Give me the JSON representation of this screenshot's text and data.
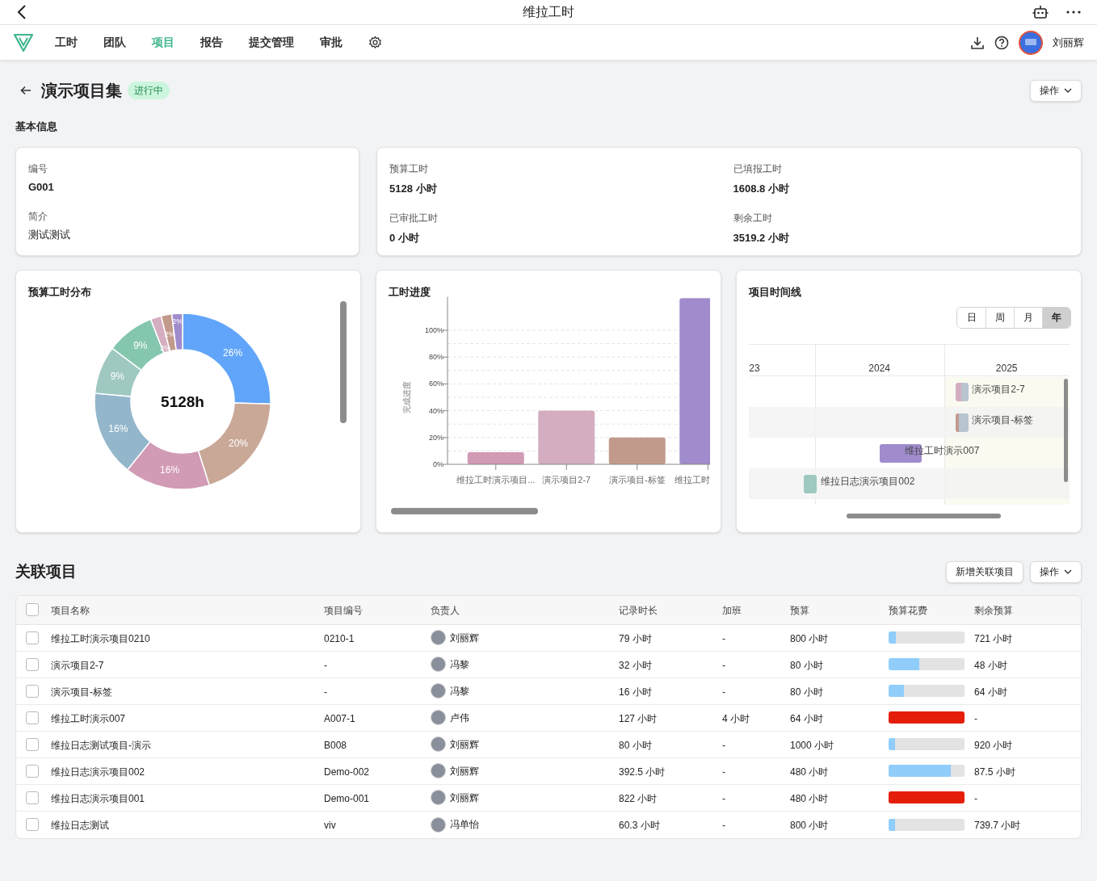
{
  "app_bar": {
    "title": "维拉工时"
  },
  "nav": {
    "items": [
      {
        "label": "工时",
        "selected": false
      },
      {
        "label": "团队",
        "selected": false
      },
      {
        "label": "项目",
        "selected": true
      },
      {
        "label": "报告",
        "selected": false
      },
      {
        "label": "提交管理",
        "selected": false
      },
      {
        "label": "审批",
        "selected": false
      }
    ],
    "user": "刘丽辉"
  },
  "header": {
    "title": "演示项目集",
    "status": "进行中",
    "action": "操作"
  },
  "basic_info": {
    "heading": "基本信息",
    "fields": [
      {
        "label": "编号",
        "value": "G001"
      },
      {
        "label": "简介",
        "value": "测试测试"
      }
    ],
    "hours": [
      {
        "label": "预算工时",
        "value": "5128 小时"
      },
      {
        "label": "已填报工时",
        "value": "1608.8 小时"
      },
      {
        "label": "已审批工时",
        "value": "0 小时"
      },
      {
        "label": "剩余工时",
        "value": "3519.2 小时"
      }
    ]
  },
  "budget_distribution": {
    "title": "预算工时分布",
    "center": "5128h",
    "chart_data": {
      "type": "donut",
      "value_labels": [
        "26%",
        "20%",
        "16%",
        "16%",
        "9%",
        "9%",
        "2%",
        "2%",
        "2%"
      ],
      "series": [
        {
          "values": [
            26,
            20,
            16,
            16,
            9,
            9,
            2,
            2,
            2
          ],
          "colors": [
            "#60a5fa",
            "#c9a898",
            "#d19ab5",
            "#94b6cb",
            "#9ec8c0",
            "#85c6ae",
            "#d4aec0",
            "#c29a8c",
            "#a08ccc"
          ]
        }
      ]
    }
  },
  "progress": {
    "title": "工时进度",
    "chart_data": {
      "type": "bar",
      "ylabel": "完成进度",
      "grid": true,
      "categories": [
        "维拉工时演示项目...",
        "演示项目2-7",
        "演示项目-标签",
        "维拉工时"
      ],
      "ylim": [
        0,
        125
      ],
      "yticks": [
        {
          "value": 0,
          "label": "0%"
        },
        {
          "value": 20,
          "label": "20%"
        },
        {
          "value": 40,
          "label": "40%"
        },
        {
          "value": 60,
          "label": "60%"
        },
        {
          "value": 80,
          "label": "80%"
        },
        {
          "value": 100,
          "label": "100%"
        }
      ],
      "series": [
        {
          "values": [
            9,
            40,
            20,
            124
          ],
          "colors": [
            "#d19ab5",
            "#d4aec0",
            "#c29a8c",
            "#a08ccc"
          ]
        }
      ]
    }
  },
  "timeline": {
    "title": "项目时间线",
    "views": [
      {
        "label": "日",
        "selected": false
      },
      {
        "label": "周",
        "selected": false
      },
      {
        "label": "月",
        "selected": false
      },
      {
        "label": "年",
        "selected": true
      }
    ],
    "years": [
      "23",
      "2024",
      "2025"
    ],
    "rows": [
      {
        "label": "演示项目2-7",
        "segments": [
          {
            "color": "#d4aec0"
          },
          {
            "color": "#b8c4d0"
          }
        ]
      },
      {
        "label": "演示项目-标签",
        "segments": [
          {
            "color": "#c29a8c"
          },
          {
            "color": "#b8c4d0"
          }
        ]
      },
      {
        "label": "维拉工时演示007",
        "segments": [
          {
            "color": "#a08ccc"
          }
        ]
      },
      {
        "label": "维拉日志演示项目002",
        "segments": [
          {
            "color": "#9ec8c0"
          }
        ]
      }
    ]
  },
  "related": {
    "title": "关联项目",
    "buttons": [
      "新增关联项目",
      "操作"
    ],
    "select_all": {
      "checked": false
    },
    "columns": [
      "项目名称",
      "项目编号",
      "负责人",
      "记录时长",
      "加班",
      "预算",
      "预算花费",
      "剩余预算"
    ],
    "rows": [
      {
        "checked": false,
        "name": "维拉工时演示项目0210",
        "code": "0210-1",
        "owner": "刘丽辉",
        "duration": "79 小时",
        "overtime": "-",
        "budget": "800 小时",
        "level": 0.1,
        "over": false,
        "remaining": "721 小时"
      },
      {
        "checked": false,
        "name": "演示项目2-7",
        "code": "-",
        "owner": "冯黎",
        "duration": "32 小时",
        "overtime": "-",
        "budget": "80 小时",
        "level": 0.4,
        "over": false,
        "remaining": "48 小时"
      },
      {
        "checked": false,
        "name": "演示项目-标签",
        "code": "-",
        "owner": "冯黎",
        "duration": "16 小时",
        "overtime": "-",
        "budget": "80 小时",
        "level": 0.2,
        "over": false,
        "remaining": "64 小时"
      },
      {
        "checked": false,
        "name": "维拉工时演示007",
        "code": "A007-1",
        "owner": "卢伟",
        "duration": "127 小时",
        "overtime": "4 小时",
        "budget": "64 小时",
        "level": 1,
        "over": true,
        "remaining": "-"
      },
      {
        "checked": false,
        "name": "维拉日志测试项目-演示",
        "code": "B008",
        "owner": "刘丽辉",
        "duration": "80 小时",
        "overtime": "-",
        "budget": "1000 小时",
        "level": 0.08,
        "over": false,
        "remaining": "920 小时"
      },
      {
        "checked": false,
        "name": "维拉日志演示项目002",
        "code": "Demo-002",
        "owner": "刘丽辉",
        "duration": "392.5 小时",
        "overtime": "-",
        "budget": "480 小时",
        "level": 0.82,
        "over": false,
        "remaining": "87.5 小时"
      },
      {
        "checked": false,
        "name": "维拉日志演示项目001",
        "code": "Demo-001",
        "owner": "刘丽辉",
        "duration": "822 小时",
        "overtime": "-",
        "budget": "480 小时",
        "level": 1,
        "over": true,
        "remaining": "-"
      },
      {
        "checked": false,
        "name": "维拉日志测试",
        "code": "viv",
        "owner": "冯单怡",
        "duration": "60.3 小时",
        "overtime": "-",
        "budget": "800 小时",
        "level": 0.08,
        "over": false,
        "remaining": "739.7 小时"
      }
    ]
  }
}
